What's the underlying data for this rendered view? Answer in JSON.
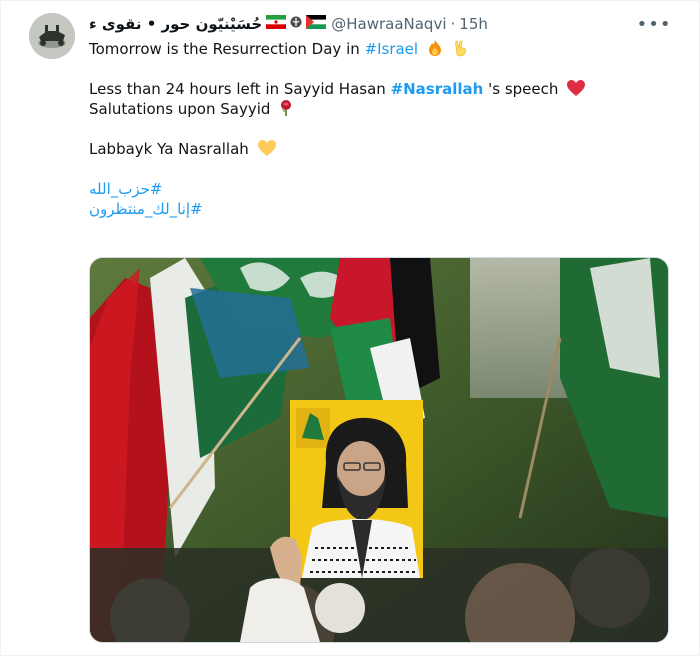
{
  "tweet": {
    "display_name": "حُسَیْنیّون‌ حور • نقوی ء",
    "separator": "•",
    "handle": "@HawraaNaqvi",
    "dot": "·",
    "time": "15h",
    "more_icon": "•••",
    "lines": {
      "l1_text": "Tomorrow is the Resurrection Day in ",
      "l1_hashtag": "#Israel",
      "l2_text": "Less than 24 hours left in Sayyid Hasan ",
      "l2_hashtag": "#Nasrallah",
      "l2_after": " 's speech",
      "l3_text": "Salutations upon Sayyid",
      "l4_text": "Labbayk Ya Nasrallah",
      "hashtag_ar_1": "#حزب_الله",
      "hashtag_ar_2": "#إنا_لك_منتظرون"
    },
    "colors": {
      "link": "#1d9bf0",
      "muted": "#536471",
      "portrait_background": "#f2c715"
    },
    "icons": [
      "iran-flag-icon",
      "palestine-flag-icon",
      "fire-emoji",
      "victory-hand-emoji",
      "red-heart-emoji",
      "rose-emoji",
      "yellow-heart-emoji",
      "more-options-icon"
    ]
  }
}
